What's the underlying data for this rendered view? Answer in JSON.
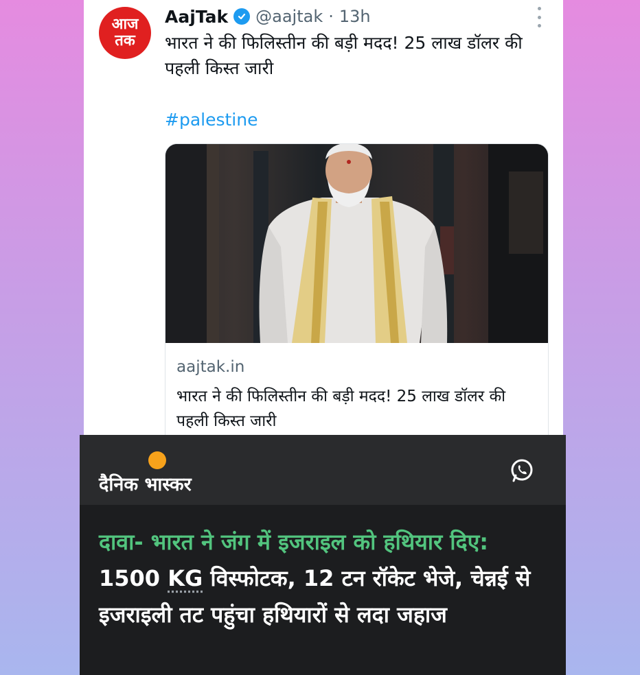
{
  "tweet": {
    "name": "AajTak",
    "avatar_top": "आज",
    "avatar_bottom": "तक",
    "handle": "@aajtak",
    "separator": "·",
    "time": "13h",
    "text": "भारत ने की फिलिस्तीन की बड़ी मदद! 25 लाख डॉलर की पहली किस्त जारी",
    "hashtag": "#palestine",
    "card": {
      "domain": "aajtak.in",
      "title": "भारत ने की फिलिस्तीन की बड़ी मदद! 25 लाख डॉलर की पहली किस्त जारी"
    }
  },
  "bhaskar": {
    "logo": "दैनिक भास्कर",
    "headline_claim": "दावा- भारत ने जंग में इजराइल को हथियार दिए:",
    "headline_num": "1500",
    "headline_kg": "KG",
    "headline_rest": "विस्फोटक, 12 टन रॉकेट भेजे, चेन्नई से इजराइली तट पहुंचा हथियारों से लदा जहाज"
  },
  "colors": {
    "accent_blue": "#1d9bf0",
    "aajtak_red": "#e02020",
    "claim_green": "#52c47e",
    "bhaskar_orange": "#f7a21b"
  },
  "icons": [
    "verified-badge-icon",
    "more-options-icon",
    "whatsapp-icon",
    "bhaskar-sun-icon"
  ]
}
